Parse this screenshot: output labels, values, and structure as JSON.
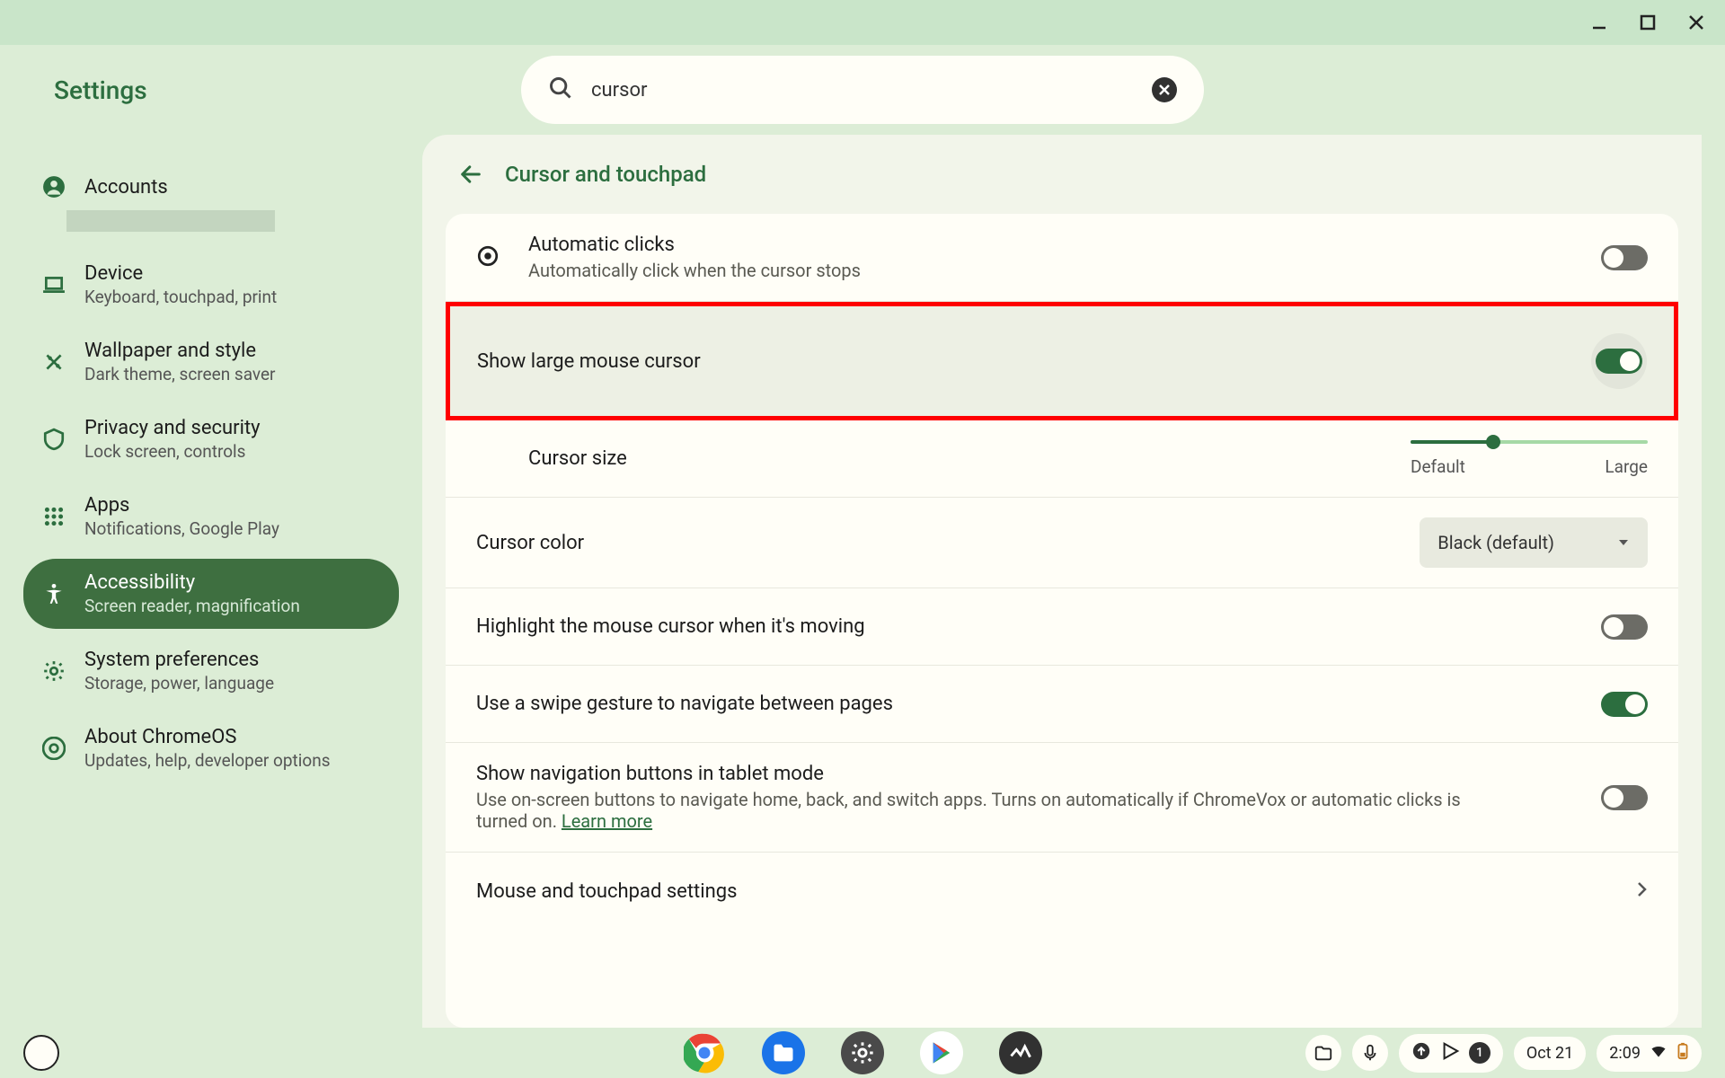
{
  "app_title": "Settings",
  "search": {
    "value": "cursor"
  },
  "sidebar": {
    "items": [
      {
        "label": "Accounts",
        "sub": ""
      },
      {
        "label": "Device",
        "sub": "Keyboard, touchpad, print"
      },
      {
        "label": "Wallpaper and style",
        "sub": "Dark theme, screen saver"
      },
      {
        "label": "Privacy and security",
        "sub": "Lock screen, controls"
      },
      {
        "label": "Apps",
        "sub": "Notifications, Google Play"
      },
      {
        "label": "Accessibility",
        "sub": "Screen reader, magnification"
      },
      {
        "label": "System preferences",
        "sub": "Storage, power, language"
      },
      {
        "label": "About ChromeOS",
        "sub": "Updates, help, developer options"
      }
    ]
  },
  "page": {
    "title": "Cursor and touchpad",
    "rows": {
      "auto_click": {
        "label": "Automatic clicks",
        "sub": "Automatically click when the cursor stops",
        "on": false
      },
      "large_cursor": {
        "label": "Show large mouse cursor",
        "on": true
      },
      "cursor_size": {
        "label": "Cursor size",
        "min_label": "Default",
        "max_label": "Large"
      },
      "cursor_color": {
        "label": "Cursor color",
        "selected": "Black (default)"
      },
      "highlight_cursor": {
        "label": "Highlight the mouse cursor when it's moving",
        "on": false
      },
      "swipe_nav": {
        "label": "Use a swipe gesture to navigate between pages",
        "on": true
      },
      "tablet_nav": {
        "label": "Show navigation buttons in tablet mode",
        "sub": "Use on-screen buttons to navigate home, back, and switch apps. Turns on automatically if ChromeVox or automatic clicks is turned on. ",
        "link": "Learn more",
        "on": false
      },
      "mouse_settings": {
        "label": "Mouse and touchpad settings"
      }
    }
  },
  "shelf": {
    "date": "Oct 21",
    "time": "2:09",
    "notif_count": "1"
  }
}
